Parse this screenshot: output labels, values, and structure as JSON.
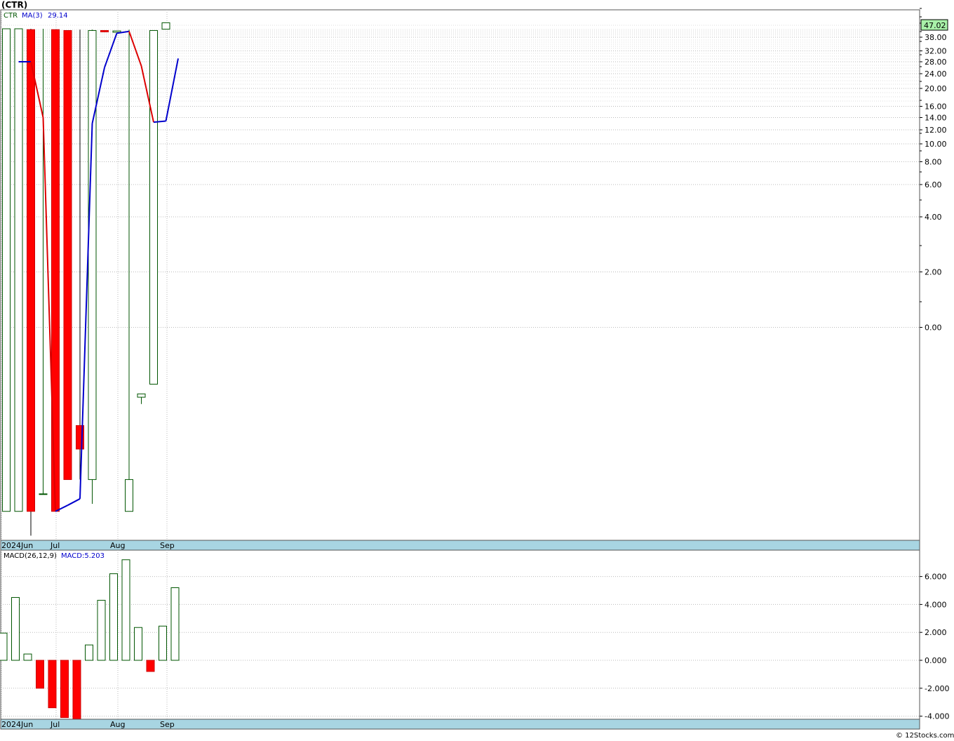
{
  "header": {
    "title": "(CTR)",
    "legend_symbol": "CTR",
    "legend_ma_label": "MA(3)",
    "legend_ma_value": "29.14",
    "last_price": "47.02"
  },
  "macd_header": {
    "label": "MACD(26,12,9)",
    "value_label": "MACD:5.203"
  },
  "footer": {
    "credit": "© 12Stocks.com"
  },
  "colors": {
    "up": "#005500",
    "down": "#cc0000",
    "down_fill": "#ff0000",
    "ma_up": "#0000cc",
    "ma_down": "#dd0000",
    "grid": "#bbbbbb",
    "date_bar": "#a8d5e2",
    "last_price_bg": "#a8f0a8"
  },
  "chart_data": [
    {
      "type": "candlestick",
      "title": "(CTR)",
      "yscale": "log",
      "y_ticks": [
        "38.00",
        "32.00",
        "28.00",
        "24.00",
        "20.00",
        "16.00",
        "14.00",
        "12.00",
        "10.00",
        "8.00",
        "6.00",
        "4.00",
        "2.00",
        "0.00"
      ],
      "x_ticks": [
        "2024Jun",
        "Jul",
        "Aug",
        "Sep"
      ],
      "series": [
        {
          "name": "CTR",
          "candles": [
            {
              "o": 0.45,
              "h": 47.0,
              "l": 0.45,
              "c": 47.0
            },
            {
              "o": 0.45,
              "h": 47.0,
              "l": 0.45,
              "c": 47.0
            },
            {
              "o": 46.0,
              "h": 47.0,
              "l": 0.32,
              "c": 0.45
            },
            {
              "o": 0.52,
              "h": 47.0,
              "l": 0.52,
              "c": 0.52
            },
            {
              "o": 46.0,
              "h": 46.0,
              "l": 0.45,
              "c": 0.45
            },
            {
              "o": 45.0,
              "h": 45.0,
              "l": 0.55,
              "c": 0.55
            },
            {
              "o": 0.68,
              "h": 46.0,
              "l": 0.55,
              "c": 0.62
            },
            {
              "o": 0.55,
              "h": 46.0,
              "l": 0.5,
              "c": 45.0
            },
            {
              "o": 45.0,
              "h": 45.0,
              "l": 43.0,
              "c": 43.5
            },
            {
              "o": 43.0,
              "h": 44.5,
              "l": 43.0,
              "c": 44.5
            },
            {
              "o": 0.45,
              "h": 46.0,
              "l": 0.45,
              "c": 0.55
            },
            {
              "o": 0.76,
              "h": 0.76,
              "l": 0.74,
              "c": 0.77
            },
            {
              "o": 0.8,
              "h": 45.0,
              "l": 0.8,
              "c": 45.0
            },
            {
              "o": 46.5,
              "h": 56.5,
              "l": 46.5,
              "c": 56.5
            }
          ]
        },
        {
          "name": "MA(3)",
          "values": [
            null,
            28.0,
            28.0,
            14.0,
            0.45,
            0.49,
            0.51,
            13.0,
            26.0,
            42.0,
            44.0,
            26.5,
            13.2,
            13.4,
            29.14
          ]
        }
      ]
    },
    {
      "type": "bar",
      "title": "MACD(26,12,9)",
      "ylim": [
        -4.2,
        7.1
      ],
      "y_ticks": [
        "6.000",
        "4.000",
        "2.000",
        "0.000",
        "-2.000",
        "-4.000"
      ],
      "x_ticks": [
        "2024Jun",
        "Jul",
        "Aug",
        "Sep"
      ],
      "values": [
        1.95,
        4.5,
        0.45,
        -2.0,
        -3.4,
        -4.1,
        -4.3,
        1.1,
        4.3,
        6.2,
        7.2,
        2.35,
        -0.8,
        2.45,
        5.2
      ]
    }
  ]
}
